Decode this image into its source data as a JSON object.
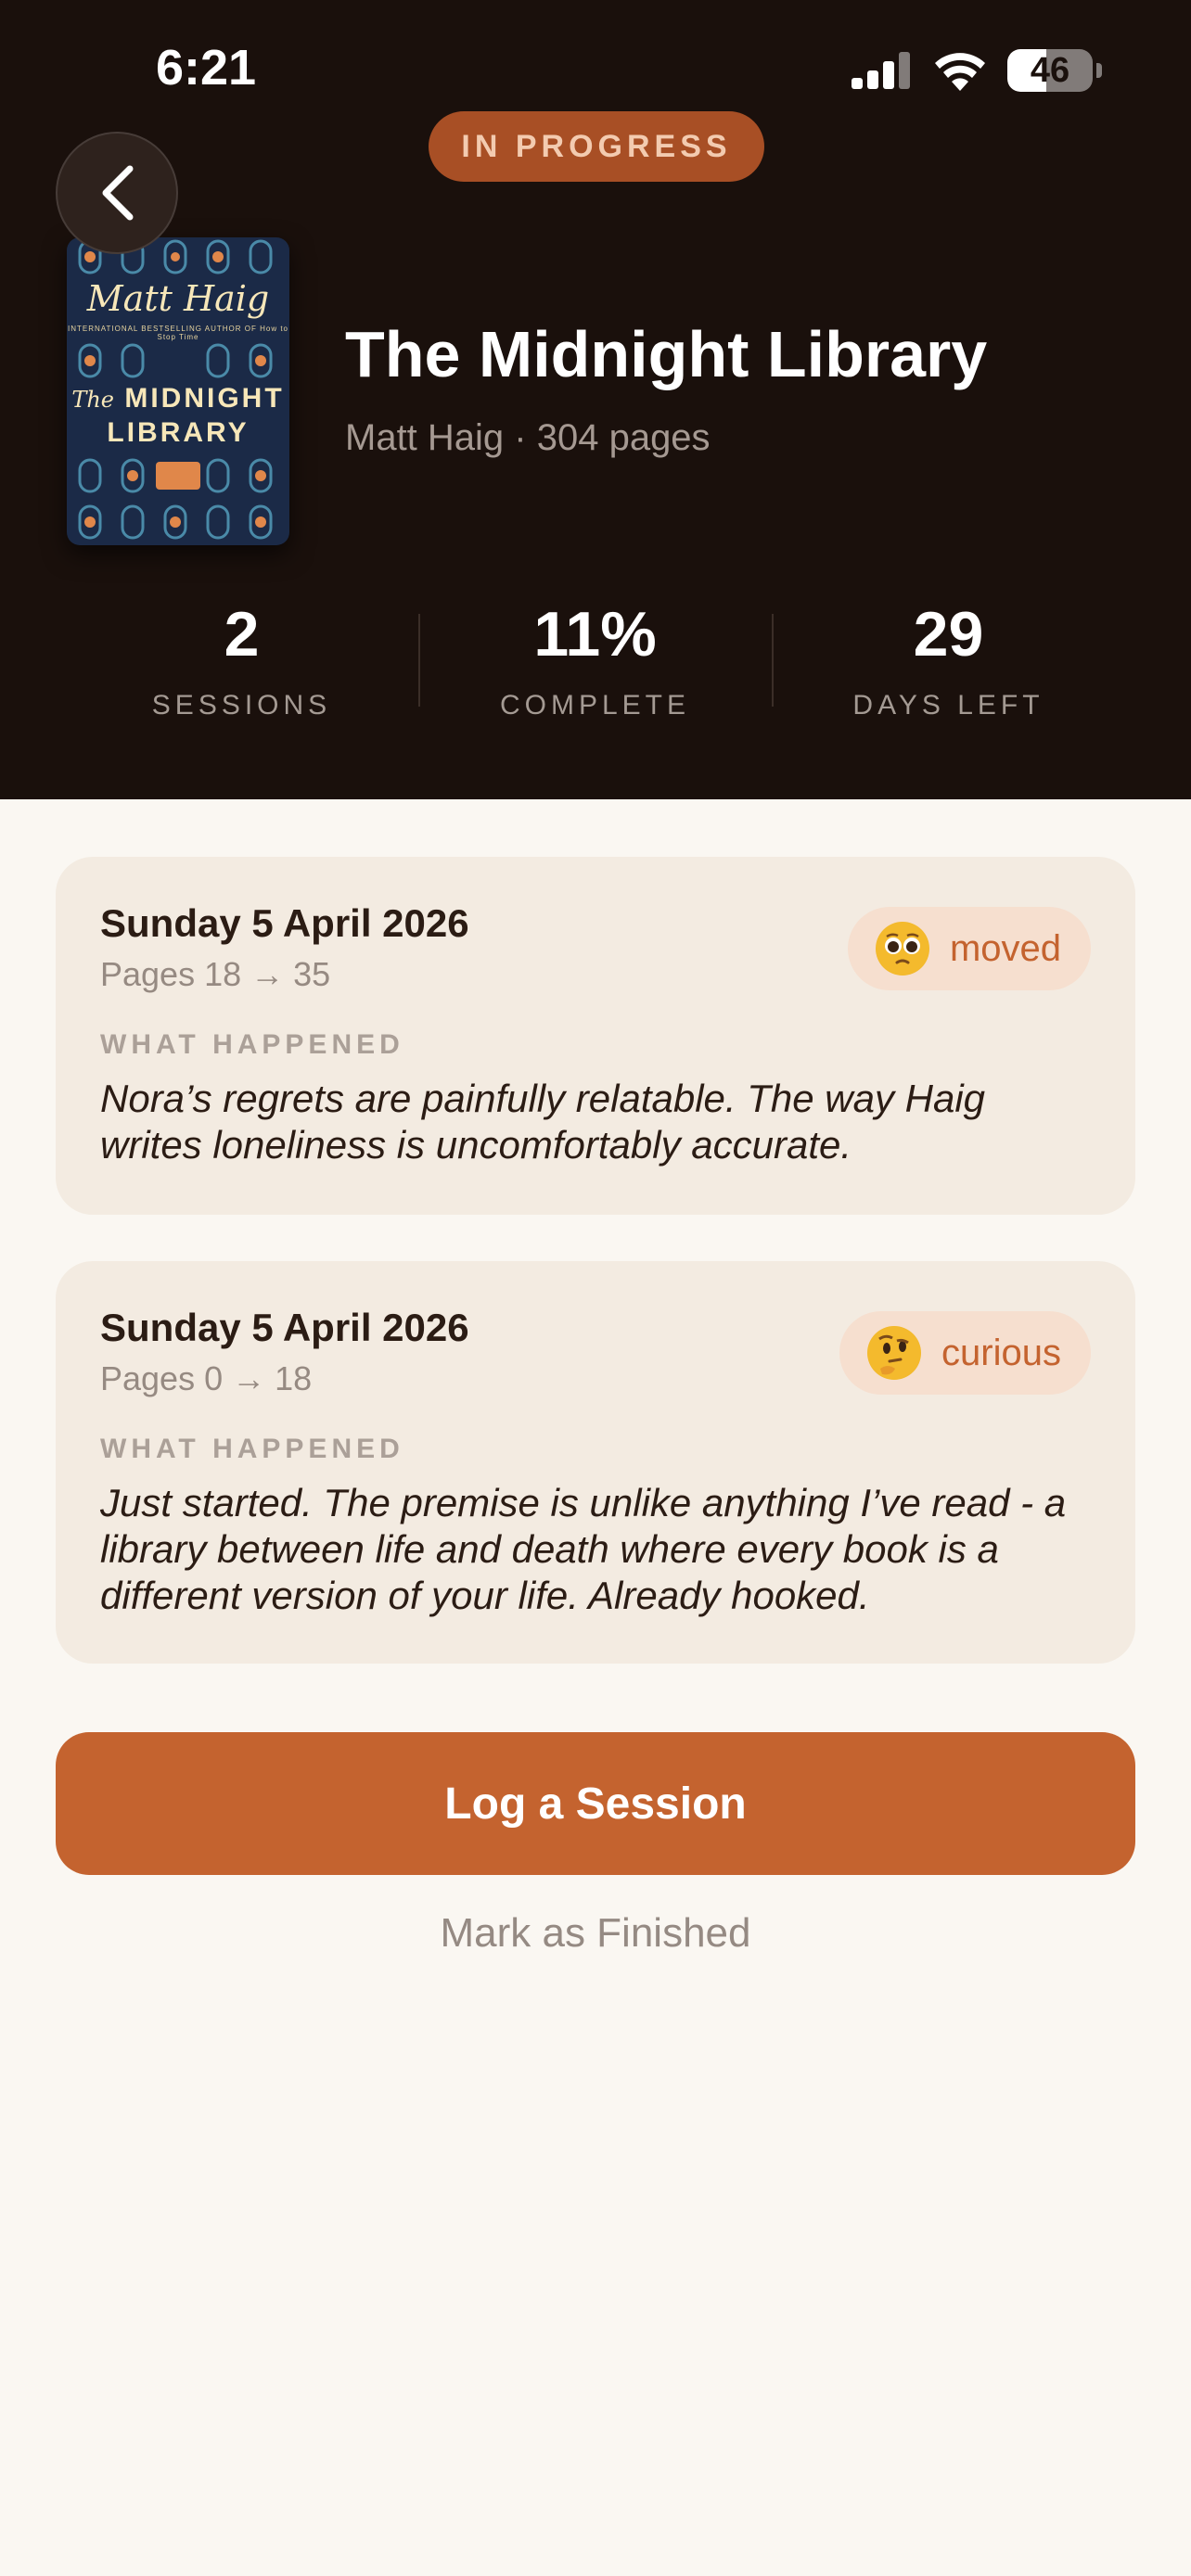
{
  "status_bar": {
    "time": "6:21",
    "battery": "46",
    "battery_level": 0.46
  },
  "header": {
    "status_badge": "IN PROGRESS"
  },
  "book": {
    "title": "The Midnight Library",
    "meta": "Matt Haig · 304 pages",
    "cover": {
      "author": "Matt Haig",
      "tagline": "INTERNATIONAL BESTSELLING AUTHOR OF How to Stop Time",
      "title_the": "The",
      "title_line1": "MIDNIGHT",
      "title_line2": "LIBRARY"
    }
  },
  "stats": [
    {
      "value": "2",
      "label": "SESSIONS"
    },
    {
      "value": "11%",
      "label": "COMPLETE"
    },
    {
      "value": "29",
      "label": "DAYS LEFT"
    }
  ],
  "sessions": [
    {
      "date": "Sunday 5 April 2026",
      "pages": "Pages 18 → 35",
      "mood": "moved",
      "mood_icon": "moved-face-emoji",
      "section_label": "WHAT HAPPENED",
      "note": "Nora’s regrets are painfully relatable. The way Haig writes loneliness is uncomfortably accurate."
    },
    {
      "date": "Sunday 5 April 2026",
      "pages": "Pages 0 → 18",
      "mood": "curious",
      "mood_icon": "thinking-face-emoji",
      "section_label": "WHAT HAPPENED",
      "note": "Just started. The premise is unlike anything I’ve read - a library between life and death where every book is a different version of your life. Already hooked."
    }
  ],
  "actions": {
    "log_session": "Log a Session",
    "mark_finished": "Mark as Finished"
  },
  "colors": {
    "accent": "#c4632f",
    "hero_bg": "#1a100c",
    "card_bg": "#f3ebe1",
    "page_bg": "#faf7f2"
  }
}
